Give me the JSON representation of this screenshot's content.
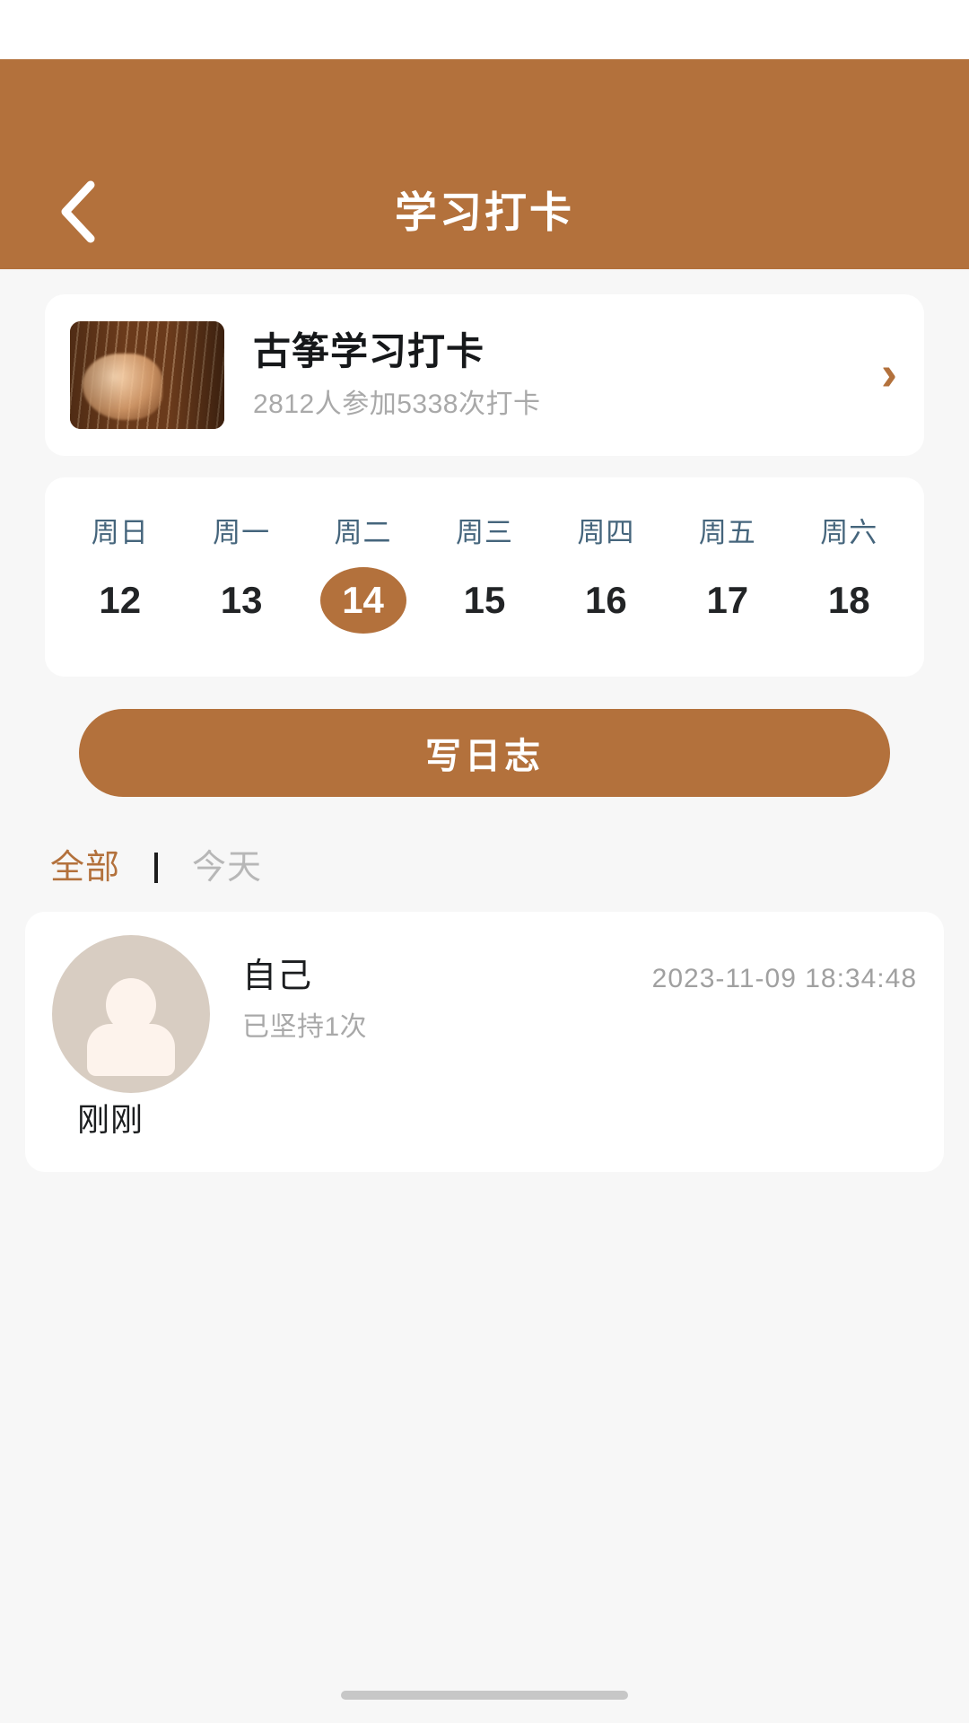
{
  "header": {
    "title": "学习打卡",
    "back_icon": "chevron-left-icon",
    "background_color": "#b3713c",
    "title_color": "#ffffff"
  },
  "course": {
    "title": "古筝学习打卡",
    "subtitle": "2812人参加5338次打卡",
    "arrow_glyph": "›",
    "arrow_icon": "chevron-right-icon",
    "thumbnail_alt": "guzheng-playing-hands"
  },
  "week": {
    "days": [
      {
        "name": "周日",
        "num": "12",
        "active": false
      },
      {
        "name": "周一",
        "num": "13",
        "active": false
      },
      {
        "name": "周二",
        "num": "14",
        "active": true
      },
      {
        "name": "周三",
        "num": "15",
        "active": false
      },
      {
        "name": "周四",
        "num": "16",
        "active": false
      },
      {
        "name": "周五",
        "num": "17",
        "active": false
      },
      {
        "name": "周六",
        "num": "18",
        "active": false
      }
    ],
    "selected_num": "14",
    "name_color": "#45657c",
    "active_color": "#b3713c"
  },
  "write_button": {
    "label": "写日志",
    "color": "#b3713c"
  },
  "tabs": {
    "all": "全部",
    "today": "今天",
    "active": "全部",
    "active_color": "#b3713c",
    "inactive_color": "#b7b7b7"
  },
  "feed": {
    "items": [
      {
        "user": "自己",
        "streak": "已坚持1次",
        "timestamp": "2023-11-09 18:34:48",
        "body": "刚刚",
        "avatar": "user-avatar-placeholder"
      }
    ]
  }
}
